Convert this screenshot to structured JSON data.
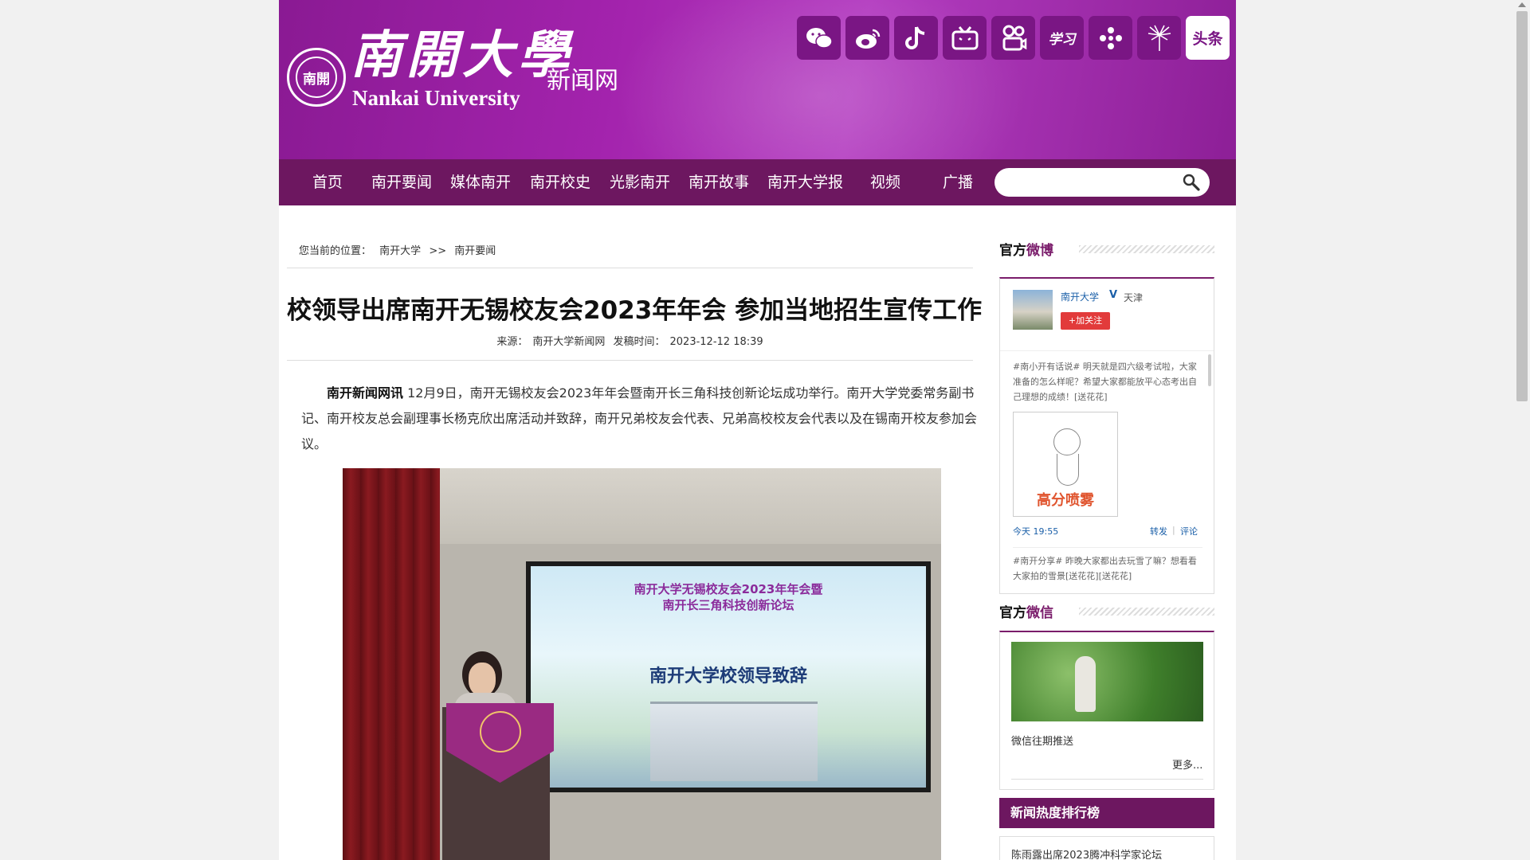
{
  "header": {
    "logo_seal_text": "南開",
    "logo_cn": "南開大學",
    "logo_en": "Nankai University",
    "site_name": "新闻网",
    "social_icons": [
      "wechat-icon",
      "weibo-icon",
      "douyin-icon",
      "bilibili-icon",
      "kuaishou-icon",
      "xuexi-icon",
      "network-icon",
      "dandelion-icon",
      "toutiao-icon"
    ],
    "toutiao_label": "头条",
    "xuexi_label": "学习"
  },
  "nav": {
    "items": [
      "首页",
      "南开要闻",
      "媒体南开",
      "南开校史",
      "光影南开",
      "南开故事",
      "南开大学报",
      "视频",
      "广播"
    ],
    "search_placeholder": ""
  },
  "breadcrumb": {
    "prefix": "您当前的位置：",
    "path": [
      "南开大学",
      ">>",
      "南开要闻"
    ]
  },
  "article": {
    "title": "校领导出席南开无锡校友会2023年年会 参加当地招生宣传工作",
    "source_label": "来源：",
    "source": "南开大学新闻网",
    "time_label": "发稿时间：",
    "time": "2023-12-12 18:39",
    "lead": "南开新闻网讯",
    "body": " 12月9日，南开无锡校友会2023年年会暨南开长三角科技创新论坛成功举行。南开大学党委常务副书记、南开校友总会副理事长杨克欣出席活动并致辞，南开兄弟校友会代表、兄弟高校校友会代表以及在锡南开校友参加会议。",
    "photo": {
      "screen_line1": "南开大学无锡校友会2023年年会暨",
      "screen_line2": "南开长三角科技创新论坛",
      "screen_line3": "南开大学校领导致辞"
    }
  },
  "sidebar": {
    "weibo": {
      "head_plain": "官方",
      "head_accent": "微博",
      "account": "南开大学",
      "verified": "V",
      "city": "天津",
      "follow": "+加关注",
      "post1": "#南小开有话说# 明天就是四六级考试啦，大家准备的怎么样呢？希望大家都能放平心态考出自己理想的成绩！[送花花]",
      "post1_image_text": "高分喷雾",
      "time": "今天 19:55",
      "repost": "转发",
      "separator": "|",
      "comment": "评论",
      "post2": "#南开分享# 昨晚大家都出去玩雪了嘛？想看看大家拍的雪景[送花花][送花花]"
    },
    "wechat": {
      "head_plain": "官方",
      "head_accent": "微信",
      "caption": "微信往期推送",
      "more": "更多..."
    },
    "ranking": {
      "head": "新闻热度排行榜",
      "first_item": "陈雨露出席2023腾冲科学家论坛"
    }
  }
}
